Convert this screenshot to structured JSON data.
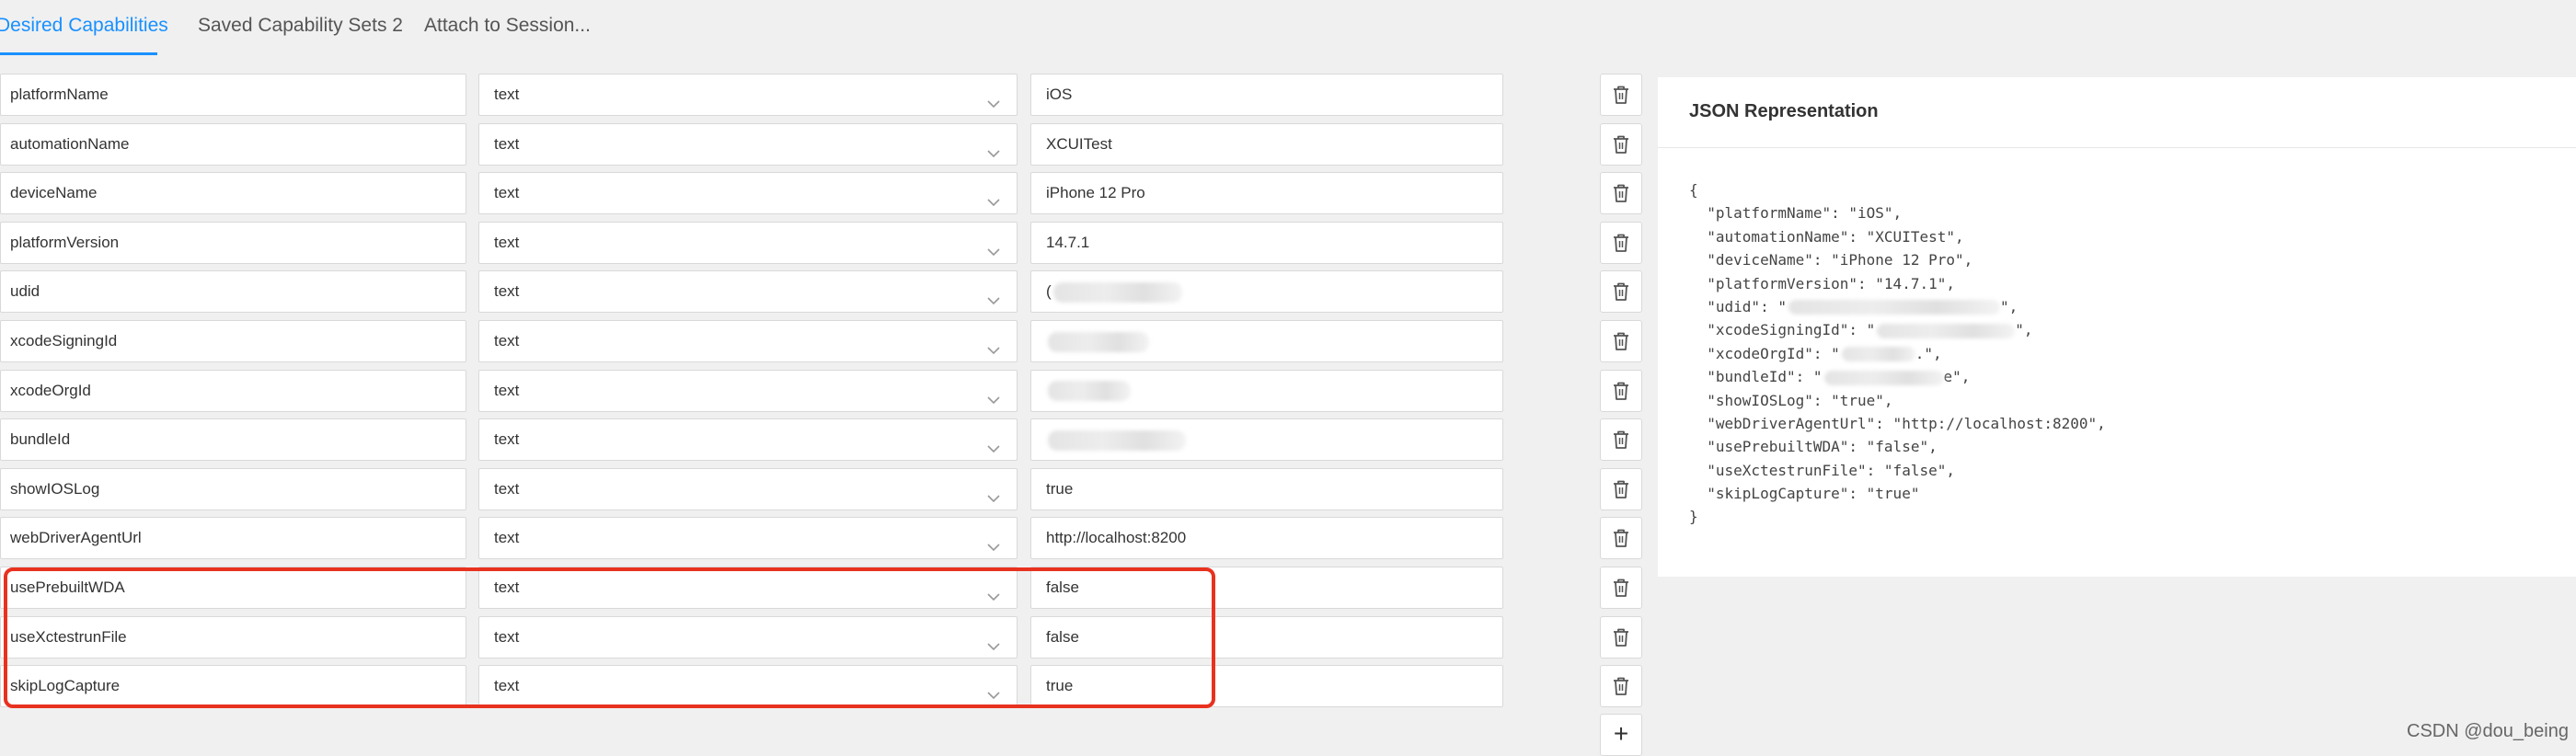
{
  "tabs": [
    {
      "label": "Desired Capabilities",
      "active": true
    },
    {
      "label": "Saved Capability Sets 2",
      "active": false
    },
    {
      "label": "Attach to Session...",
      "active": false
    }
  ],
  "capabilities": [
    {
      "name": "platformName",
      "type": "text",
      "value": "iOS"
    },
    {
      "name": "automationName",
      "type": "text",
      "value": "XCUITest"
    },
    {
      "name": "deviceName",
      "type": "text",
      "value": "iPhone 12 Pro"
    },
    {
      "name": "platformVersion",
      "type": "text",
      "value": "14.7.1"
    },
    {
      "name": "udid",
      "type": "text",
      "value": "(",
      "redacted": true
    },
    {
      "name": "xcodeSigningId",
      "type": "text",
      "value": "",
      "redacted": true
    },
    {
      "name": "xcodeOrgId",
      "type": "text",
      "value": "",
      "redacted": true
    },
    {
      "name": "bundleId",
      "type": "text",
      "value": "",
      "redacted": true
    },
    {
      "name": "showIOSLog",
      "type": "text",
      "value": "true"
    },
    {
      "name": "webDriverAgentUrl",
      "type": "text",
      "value": "http://localhost:8200"
    },
    {
      "name": "usePrebuiltWDA",
      "type": "text",
      "value": "false"
    },
    {
      "name": "useXctestrunFile",
      "type": "text",
      "value": "false"
    },
    {
      "name": "skipLogCapture",
      "type": "text",
      "value": "true"
    }
  ],
  "add_button_label": "+",
  "json_panel": {
    "title": "JSON Representation",
    "lines": [
      "{",
      "  \"platformName\": \"iOS\",",
      "  \"automationName\": \"XCUITest\",",
      "  \"deviceName\": \"iPhone 12 Pro\",",
      "  \"platformVersion\": \"14.7.1\",",
      "  \"udid\": \"",
      "  \"xcodeSigningId\": \"",
      "  \"xcodeOrgId\": \"",
      "  \"bundleId\": \"",
      "  \"showIOSLog\": \"true\",",
      "  \"webDriverAgentUrl\": \"http://localhost:8200\",",
      "  \"usePrebuiltWDA\": \"false\",",
      "  \"useXctestrunFile\": \"false\",",
      "  \"skipLogCapture\": \"true\"",
      "}"
    ],
    "redacted_line_tails": {
      "5": "\",",
      "6": "\",",
      "7": ".\",",
      "8": "e\","
    }
  },
  "watermark": "CSDN @dou_being",
  "colors": {
    "accent": "#1890ff",
    "highlight": "#e8321f",
    "background": "#f0f0f0"
  }
}
